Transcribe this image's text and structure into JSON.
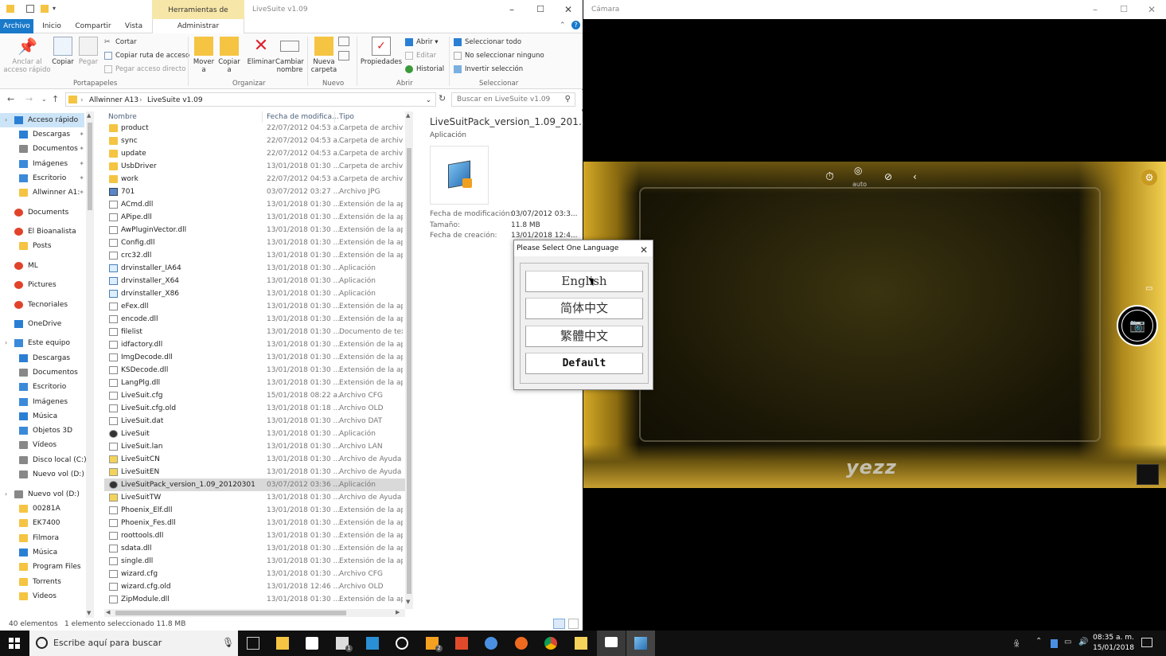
{
  "explorer": {
    "title": "LiveSuite v1.09",
    "context_tab": "Herramientas de aplicación",
    "ribbon_tabs": [
      "Archivo",
      "Inicio",
      "Compartir",
      "Vista",
      "Administrar"
    ],
    "groups": {
      "portapapeles": "Portapapeles",
      "organizar": "Organizar",
      "nuevo": "Nuevo",
      "abrir": "Abrir",
      "seleccionar": "Seleccionar"
    },
    "buttons": {
      "anclar": "Anclar al acceso rápido",
      "copiar": "Copiar",
      "pegar": "Pegar",
      "cortar": "Cortar",
      "copiar_ruta": "Copiar ruta de acceso",
      "pegar_acceso": "Pegar acceso directo",
      "mover": "Mover a",
      "copiar_a": "Copiar a",
      "eliminar": "Eliminar",
      "cambiar_nombre": "Cambiar nombre",
      "nueva_carpeta": "Nueva carpeta",
      "propiedades": "Propiedades",
      "abrir": "Abrir",
      "editar": "Editar",
      "historial": "Historial",
      "seleccionar_todo": "Seleccionar todo",
      "no_seleccionar": "No seleccionar ninguno",
      "invertir": "Invertir selección"
    },
    "address": {
      "crumb1": "Allwinner A13",
      "crumb2": "LiveSuite v1.09",
      "search_placeholder": "Buscar en LiveSuite v1.09"
    },
    "nav": [
      {
        "label": "Acceso rápido",
        "icon": "star-icon"
      },
      {
        "label": "Descargas",
        "icon": "download-icon",
        "pin": true
      },
      {
        "label": "Documentos",
        "icon": "documents-icon",
        "pin": true
      },
      {
        "label": "Imágenes",
        "icon": "images-icon",
        "pin": true
      },
      {
        "label": "Escritorio",
        "icon": "desktop-icon",
        "pin": true
      },
      {
        "label": "Allwinner A1:",
        "icon": "folder-icon",
        "pin": true
      },
      {
        "label": "Documents",
        "icon": "chrome-folder-icon"
      },
      {
        "label": "El Bioanalista",
        "icon": "chrome-folder-icon"
      },
      {
        "label": "Posts",
        "icon": "folder-icon"
      },
      {
        "label": "ML",
        "icon": "chrome-folder-icon"
      },
      {
        "label": "Pictures",
        "icon": "chrome-folder-icon"
      },
      {
        "label": "Tecnoriales",
        "icon": "chrome-folder-icon"
      },
      {
        "label": "OneDrive",
        "icon": "cloud-icon"
      },
      {
        "label": "Este equipo",
        "icon": "computer-icon"
      },
      {
        "label": "Descargas",
        "icon": "download-icon"
      },
      {
        "label": "Documentos",
        "icon": "documents-icon"
      },
      {
        "label": "Escritorio",
        "icon": "desktop-icon"
      },
      {
        "label": "Imágenes",
        "icon": "images-icon"
      },
      {
        "label": "Música",
        "icon": "music-icon"
      },
      {
        "label": "Objetos 3D",
        "icon": "cube-icon"
      },
      {
        "label": "Vídeos",
        "icon": "video-icon"
      },
      {
        "label": "Disco local (C:)",
        "icon": "drive-icon"
      },
      {
        "label": "Nuevo vol (D:)",
        "icon": "drive-icon"
      },
      {
        "label": "Nuevo vol (D:)",
        "icon": "drive-icon"
      },
      {
        "label": "00281A",
        "icon": "folder-icon"
      },
      {
        "label": "EK7400",
        "icon": "folder-icon"
      },
      {
        "label": "Filmora",
        "icon": "folder-icon"
      },
      {
        "label": "Música",
        "icon": "music-icon"
      },
      {
        "label": "Program Files",
        "icon": "folder-icon"
      },
      {
        "label": "Torrents",
        "icon": "folder-icon"
      },
      {
        "label": "Videos",
        "icon": "folder-icon"
      }
    ],
    "columns": {
      "name": "Nombre",
      "date": "Fecha de modifica...",
      "type": "Tipo"
    },
    "files": [
      {
        "name": "product",
        "date": "22/07/2012 04:53 a...",
        "type": "Carpeta de archivos",
        "icon": "folder"
      },
      {
        "name": "sync",
        "date": "22/07/2012 04:53 a...",
        "type": "Carpeta de archivos",
        "icon": "folder"
      },
      {
        "name": "update",
        "date": "22/07/2012 04:53 a...",
        "type": "Carpeta de archivos",
        "icon": "folder"
      },
      {
        "name": "UsbDriver",
        "date": "13/01/2018 01:30 ...",
        "type": "Carpeta de archivos",
        "icon": "folder"
      },
      {
        "name": "work",
        "date": "22/07/2012 04:53 a...",
        "type": "Carpeta de archivos",
        "icon": "folder"
      },
      {
        "name": "701",
        "date": "03/07/2012 03:27 ...",
        "type": "Archivo JPG",
        "icon": "img"
      },
      {
        "name": "ACmd.dll",
        "date": "13/01/2018 01:30 ...",
        "type": "Extensión de la apl...",
        "icon": "dll"
      },
      {
        "name": "APipe.dll",
        "date": "13/01/2018 01:30 ...",
        "type": "Extensión de la apl...",
        "icon": "dll"
      },
      {
        "name": "AwPluginVector.dll",
        "date": "13/01/2018 01:30 ...",
        "type": "Extensión de la apl...",
        "icon": "dll"
      },
      {
        "name": "Config.dll",
        "date": "13/01/2018 01:30 ...",
        "type": "Extensión de la apl...",
        "icon": "dll"
      },
      {
        "name": "crc32.dll",
        "date": "13/01/2018 01:30 ...",
        "type": "Extensión de la apl...",
        "icon": "dll"
      },
      {
        "name": "drvinstaller_IA64",
        "date": "13/01/2018 01:30 ...",
        "type": "Aplicación",
        "icon": "exe"
      },
      {
        "name": "drvinstaller_X64",
        "date": "13/01/2018 01:30 ...",
        "type": "Aplicación",
        "icon": "exe"
      },
      {
        "name": "drvinstaller_X86",
        "date": "13/01/2018 01:30 ...",
        "type": "Aplicación",
        "icon": "exe"
      },
      {
        "name": "eFex.dll",
        "date": "13/01/2018 01:30 ...",
        "type": "Extensión de la apl...",
        "icon": "dll"
      },
      {
        "name": "encode.dll",
        "date": "13/01/2018 01:30 ...",
        "type": "Extensión de la apl...",
        "icon": "dll"
      },
      {
        "name": "filelist",
        "date": "13/01/2018 01:30 ...",
        "type": "Documento de tex...",
        "icon": "file"
      },
      {
        "name": "idfactory.dll",
        "date": "13/01/2018 01:30 ...",
        "type": "Extensión de la apl...",
        "icon": "dll"
      },
      {
        "name": "ImgDecode.dll",
        "date": "13/01/2018 01:30 ...",
        "type": "Extensión de la apl...",
        "icon": "dll"
      },
      {
        "name": "KSDecode.dll",
        "date": "13/01/2018 01:30 ...",
        "type": "Extensión de la apl...",
        "icon": "dll"
      },
      {
        "name": "LangPlg.dll",
        "date": "13/01/2018 01:30 ...",
        "type": "Extensión de la apl...",
        "icon": "dll"
      },
      {
        "name": "LiveSuit.cfg",
        "date": "15/01/2018 08:22 a...",
        "type": "Archivo CFG",
        "icon": "file"
      },
      {
        "name": "LiveSuit.cfg.old",
        "date": "13/01/2018 01:18 ...",
        "type": "Archivo OLD",
        "icon": "file"
      },
      {
        "name": "LiveSuit.dat",
        "date": "13/01/2018 01:30 ...",
        "type": "Archivo DAT",
        "icon": "file"
      },
      {
        "name": "LiveSuit",
        "date": "13/01/2018 01:30 ...",
        "type": "Aplicación",
        "icon": "app"
      },
      {
        "name": "LiveSuit.lan",
        "date": "13/01/2018 01:30 ...",
        "type": "Archivo LAN",
        "icon": "file"
      },
      {
        "name": "LiveSuitCN",
        "date": "13/01/2018 01:30 ...",
        "type": "Archivo de Ayuda ...",
        "icon": "help"
      },
      {
        "name": "LiveSuitEN",
        "date": "13/01/2018 01:30 ...",
        "type": "Archivo de Ayuda ...",
        "icon": "help"
      },
      {
        "name": "LiveSuitPack_version_1.09_20120301",
        "date": "03/07/2012 03:36 ...",
        "type": "Aplicación",
        "icon": "app",
        "selected": true
      },
      {
        "name": "LiveSuitTW",
        "date": "13/01/2018 01:30 ...",
        "type": "Archivo de Ayuda ...",
        "icon": "help"
      },
      {
        "name": "Phoenix_Elf.dll",
        "date": "13/01/2018 01:30 ...",
        "type": "Extensión de la apl...",
        "icon": "dll"
      },
      {
        "name": "Phoenix_Fes.dll",
        "date": "13/01/2018 01:30 ...",
        "type": "Extensión de la apl...",
        "icon": "dll"
      },
      {
        "name": "roottools.dll",
        "date": "13/01/2018 01:30 ...",
        "type": "Extensión de la apl...",
        "icon": "dll"
      },
      {
        "name": "sdata.dll",
        "date": "13/01/2018 01:30 ...",
        "type": "Extensión de la apl...",
        "icon": "dll"
      },
      {
        "name": "single.dll",
        "date": "13/01/2018 01:30 ...",
        "type": "Extensión de la apl...",
        "icon": "dll"
      },
      {
        "name": "wizard.cfg",
        "date": "13/01/2018 01:30 ...",
        "type": "Archivo CFG",
        "icon": "file"
      },
      {
        "name": "wizard.cfg.old",
        "date": "13/01/2018 12:46 ...",
        "type": "Archivo OLD",
        "icon": "file"
      },
      {
        "name": "ZipModule.dll",
        "date": "13/01/2018 01:30 ...",
        "type": "Extensión de la apl...",
        "icon": "dll"
      }
    ],
    "preview": {
      "title": "LiveSuitPack_version_1.09_201...",
      "type": "Aplicación",
      "mod_label": "Fecha de modificación:",
      "mod_value": "03/07/2012 03:3...",
      "size_label": "Tamaño:",
      "size_value": "11.8 MB",
      "created_label": "Fecha de creación:",
      "created_value": "13/01/2018 12:4..."
    },
    "status": {
      "count": "40 elementos",
      "selection": "1 elemento seleccionado  11.8 MB"
    }
  },
  "camera": {
    "title": "Cámara",
    "auto_label": "auto",
    "brand": "yezz"
  },
  "dialog": {
    "title": "Please Select One Language",
    "options": [
      "English",
      "简体中文",
      "繁體中文",
      "Default"
    ]
  },
  "taskbar": {
    "search_placeholder": "Escribe aquí para buscar",
    "time": "08:35 a. m.",
    "date": "15/01/2018",
    "badge_mail": "1",
    "badge_app": "2"
  },
  "colors": {
    "accent": "#1979ca",
    "context_tab": "#f6e6a8",
    "selection": "#cce4f7"
  }
}
